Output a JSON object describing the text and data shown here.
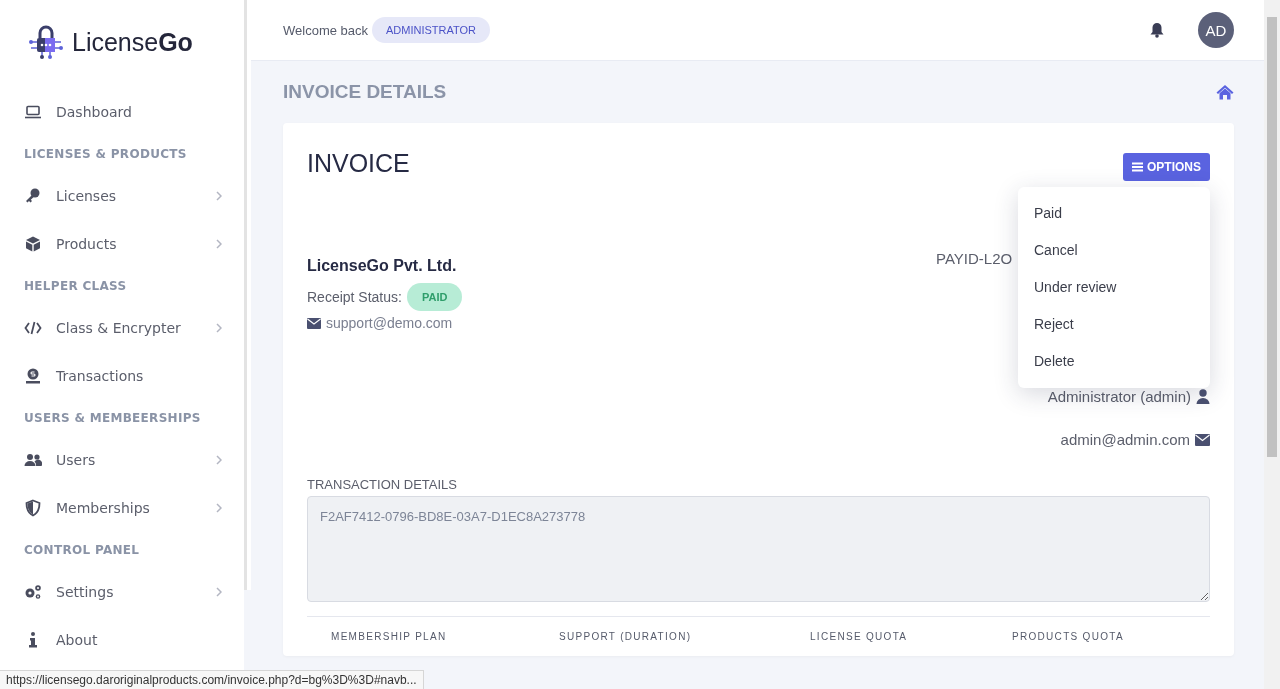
{
  "brand": {
    "name_plain": "License",
    "name_bold": "Go"
  },
  "sidebar": {
    "items": [
      {
        "kind": "item",
        "label": "Dashboard",
        "has_submenu": false
      },
      {
        "kind": "section",
        "label": "LICENSES & PRODUCTS"
      },
      {
        "kind": "item",
        "label": "Licenses",
        "has_submenu": true
      },
      {
        "kind": "item",
        "label": "Products",
        "has_submenu": true
      },
      {
        "kind": "section",
        "label": "HELPER CLASS"
      },
      {
        "kind": "item",
        "label": "Class & Encrypter",
        "has_submenu": true
      },
      {
        "kind": "item",
        "label": "Transactions",
        "has_submenu": false
      },
      {
        "kind": "section",
        "label": "USERS & MEMBEERSHIPS"
      },
      {
        "kind": "item",
        "label": "Users",
        "has_submenu": true
      },
      {
        "kind": "item",
        "label": "Memberships",
        "has_submenu": true
      },
      {
        "kind": "section",
        "label": "CONTROL PANEL"
      },
      {
        "kind": "item",
        "label": "Settings",
        "has_submenu": true
      },
      {
        "kind": "item",
        "label": "About",
        "has_submenu": false
      }
    ]
  },
  "topbar": {
    "welcome": "Welcome back",
    "role_badge": "ADMINISTRATOR",
    "avatar": "AD"
  },
  "page_title": "INVOICE DETAILS",
  "invoice": {
    "title": "INVOICE",
    "options_button": "OPTIONS",
    "options_menu": [
      "Paid",
      "Cancel",
      "Under review",
      "Reject",
      "Delete"
    ],
    "company": "LicenseGo Pvt. Ltd.",
    "receipt_status_label": "Receipt Status:",
    "receipt_status": "PAID",
    "company_email": "support@demo.com",
    "payment_id": "PAYID-L2O",
    "customer_name": "Administrator (admin)",
    "customer_email": "admin@admin.com",
    "transaction_label": "TRANSACTION DETAILS",
    "transaction_value": "F2AF7412-0796-BD8E-03A7-D1EC8A273778",
    "table": {
      "columns": [
        "MEMBERSHIP PLAN",
        "SUPPORT (DURATION)",
        "LICENSE QUOTA",
        "PRODUCTS QUOTA"
      ]
    }
  },
  "status_bar": "https://licensego.daroriginalproducts.com/invoice.php?d=bg%3D%3D#navb..."
}
